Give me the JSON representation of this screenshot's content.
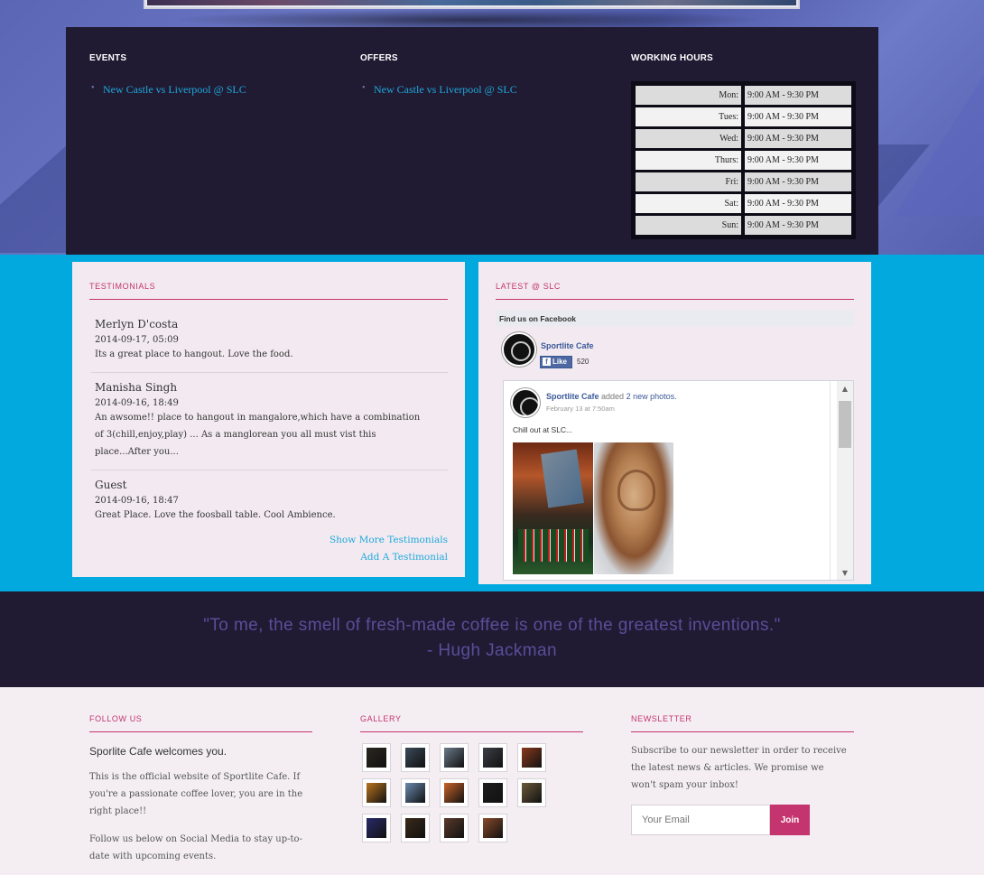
{
  "info": {
    "events_title": "EVENTS",
    "events": [
      "New Castle vs Liverpool @ SLC"
    ],
    "offers_title": "OFFERS",
    "offers": [
      "New Castle vs Liverpool @ SLC"
    ],
    "hours_title": "WORKING HOURS",
    "hours": [
      {
        "day": "Mon:",
        "time": "9:00 AM - 9:30 PM"
      },
      {
        "day": "Tues:",
        "time": "9:00 AM - 9:30 PM"
      },
      {
        "day": "Wed:",
        "time": "9:00 AM - 9:30 PM"
      },
      {
        "day": "Thurs:",
        "time": "9:00 AM - 9:30 PM"
      },
      {
        "day": "Fri:",
        "time": "9:00 AM - 9:30 PM"
      },
      {
        "day": "Sat:",
        "time": "9:00 AM - 9:30 PM"
      },
      {
        "day": "Sun:",
        "time": "9:00 AM - 9:30 PM"
      }
    ]
  },
  "testimonials": {
    "title": "TESTIMONIALS",
    "items": [
      {
        "name": "Merlyn D'costa",
        "date": "2014-09-17, 05:09",
        "text": "Its a great place to hangout. Love the food."
      },
      {
        "name": "Manisha Singh",
        "date": "2014-09-16, 18:49",
        "text_lines": [
          "An awsome!! place to hangout in mangalore,which have a combination",
          "of 3(chill,enjoy,play) ... As a manglorean you all must vist this",
          "place...After you..."
        ]
      },
      {
        "name": "Guest",
        "date": "2014-09-16, 18:47",
        "text": "Great Place. Love the foosball table. Cool Ambience."
      }
    ],
    "more_link": "Show More Testimonials",
    "add_link": "Add A Testimonial"
  },
  "latest": {
    "title": "LATEST @ SLC",
    "fb_header": "Find us on Facebook",
    "page_name": "Sportlite Cafe",
    "like_label": "Like",
    "like_count": "520",
    "post_author": "Sportlite Cafe",
    "post_action": "added",
    "post_object": "2 new photos.",
    "post_date": "February 13 at 7:50am",
    "post_text": "Chill out at SLC..."
  },
  "quote": {
    "line1": "\"To me, the smell of fresh-made coffee is one of the greatest inventions.\"",
    "line2": "- Hugh Jackman"
  },
  "footer": {
    "follow_title": "FOLLOW US",
    "welcome": "Sporlite Cafe welcomes you.",
    "para1_lines": [
      "This is the official website of Sportlite Cafe. If",
      "you're a passionate coffee lover, you are in the",
      "right place!!"
    ],
    "para2_lines": [
      "Follow us below on Social Media to stay up-to-",
      "date with upcoming events."
    ],
    "gallery_title": "GALLERY",
    "gallery_colors": [
      "#2b2620",
      "#3a4a5a",
      "#6a7a8a",
      "#3b3f46",
      "#8a3a1e",
      "#b8741f",
      "#6a8ab0",
      "#c8642a",
      "#1e1e1e",
      "#6b5a3a",
      "#2a2a6a",
      "#3a2a1a",
      "#5a3a2a",
      "#8a4a2a"
    ],
    "newsletter_title": "NEWSLETTER",
    "newsletter_lines": [
      "Subscribe to our newsletter in order to receive",
      "the latest news & articles. We promise we",
      "won't spam your inbox!"
    ],
    "email_placeholder": "Your Email",
    "join_label": "Join"
  }
}
